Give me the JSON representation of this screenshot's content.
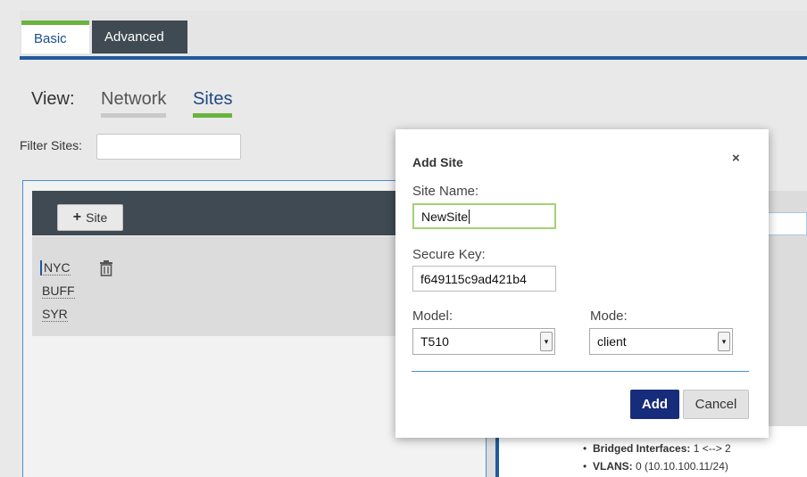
{
  "tabs": {
    "basic": "Basic",
    "advanced": "Advanced"
  },
  "view": {
    "label": "View:",
    "network": "Network",
    "sites": "Sites",
    "selected": "Sites"
  },
  "filter": {
    "label": "Filter Sites:",
    "value": ""
  },
  "sites_panel": {
    "add_button": "Site",
    "add_icon": "plus-icon",
    "sites": [
      "NYC",
      "BUFF",
      "SYR"
    ],
    "selected": "NYC"
  },
  "details": {
    "bridged_label": "Bridged Interfaces:",
    "bridged_value": " 1 <--> 2",
    "vlans_label": "VLANS:",
    "vlans_value": " 0 (10.10.100.11/24)"
  },
  "dialog": {
    "title": "Add Site",
    "close": "×",
    "site_name_label": "Site Name:",
    "site_name_value": "NewSite",
    "secure_key_label": "Secure Key:",
    "secure_key_value": "f649115c9ad421b4",
    "model_label": "Model:",
    "model_value": "T510",
    "mode_label": "Mode:",
    "mode_value": "client",
    "add": "Add",
    "cancel": "Cancel"
  },
  "colors": {
    "accent_green": "#6ab33e",
    "accent_blue": "#1f5a9c",
    "primary_button": "#172c7a",
    "dark_bar": "#3f4a52"
  }
}
